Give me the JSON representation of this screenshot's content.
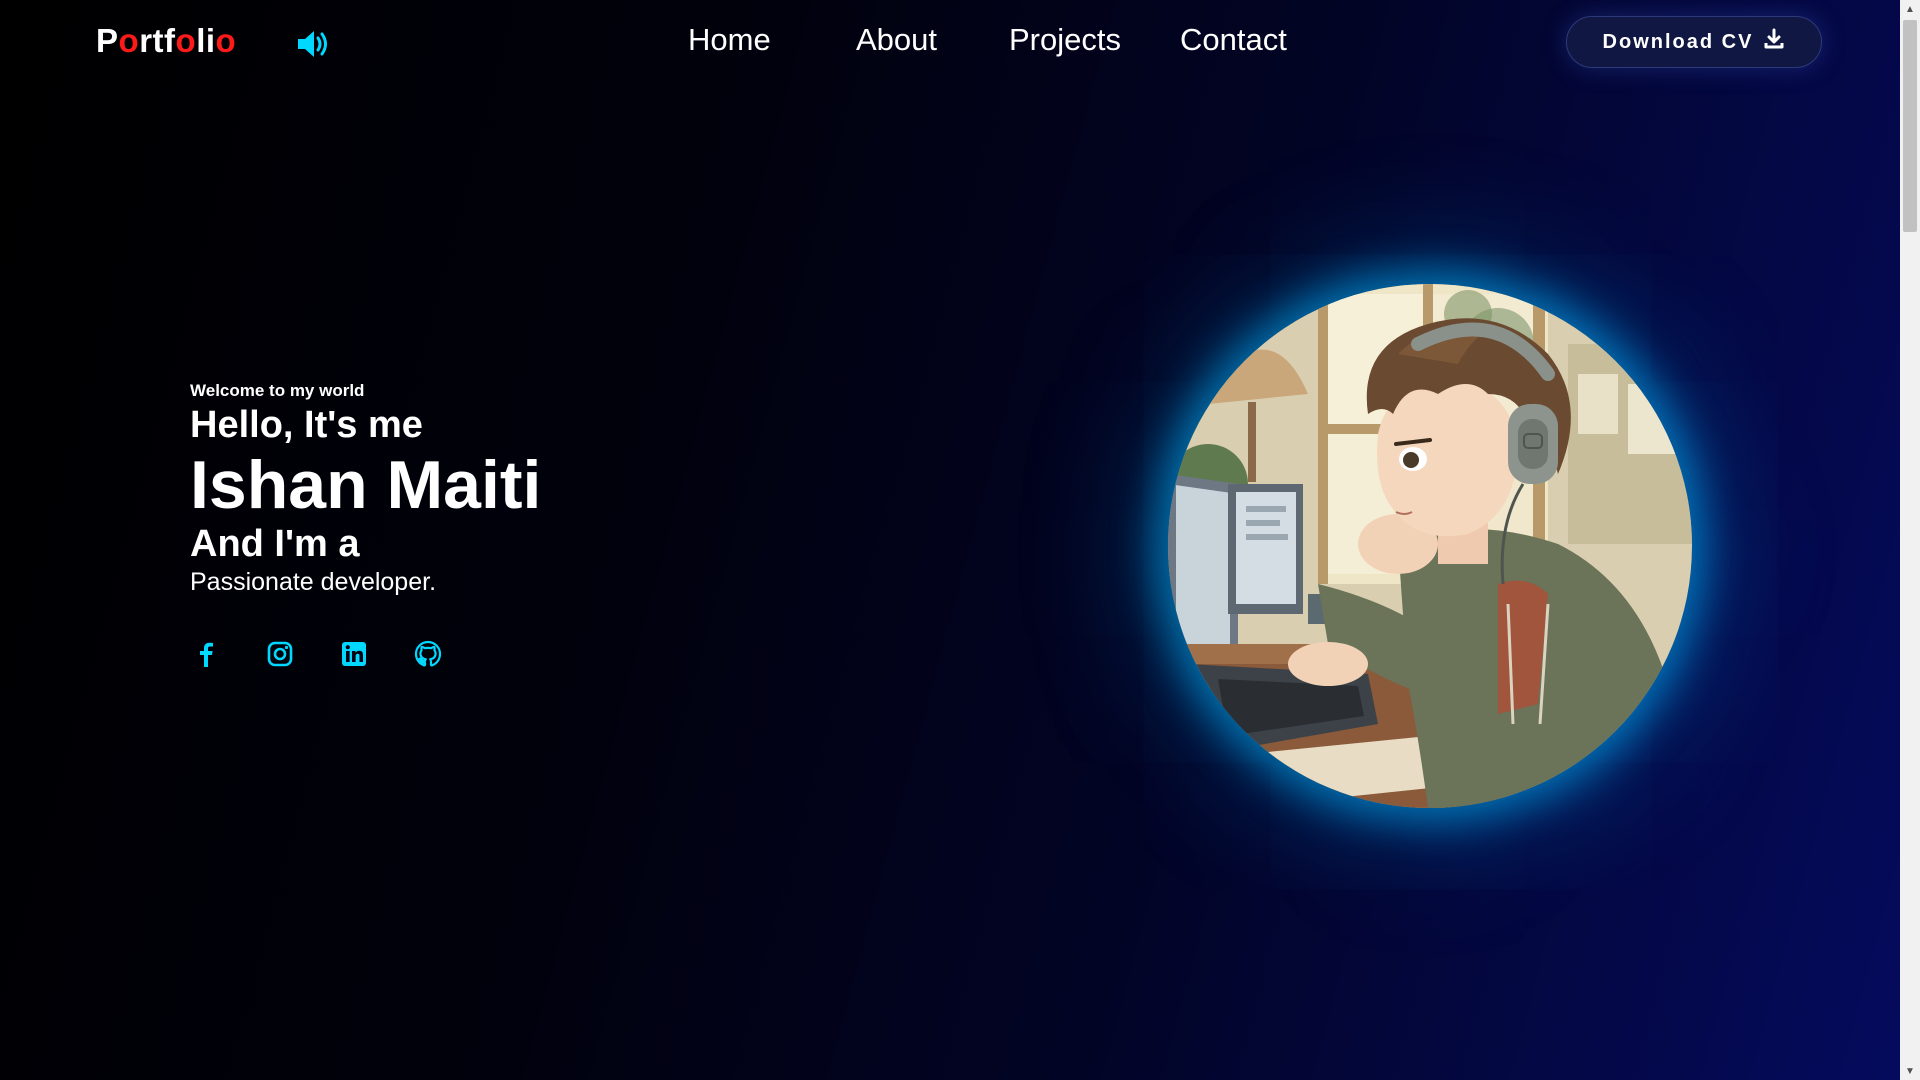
{
  "header": {
    "logo_letters": [
      {
        "char": "P",
        "color": "#ffffff"
      },
      {
        "char": "o",
        "color": "#ff1a1a"
      },
      {
        "char": "r",
        "color": "#ffffff"
      },
      {
        "char": "t",
        "color": "#ffffff"
      },
      {
        "char": "f",
        "color": "#ffffff"
      },
      {
        "char": "o",
        "color": "#ff1a1a"
      },
      {
        "char": "l",
        "color": "#ffffff"
      },
      {
        "char": "i",
        "color": "#ffffff"
      },
      {
        "char": "o",
        "color": "#ff1a1a"
      }
    ],
    "sound_icon": "volume-high-icon",
    "nav": [
      "Home",
      "About",
      "Projects",
      "Contact"
    ],
    "cv_button_label": "Download CV",
    "cv_button_icon": "download-icon"
  },
  "hero": {
    "welcome": "Welcome to my world",
    "greeting": "Hello, It's me",
    "name": "Ishan Maiti",
    "intro": "And I'm a",
    "role": "Passionate developer."
  },
  "socials": [
    {
      "icon": "facebook-icon"
    },
    {
      "icon": "instagram-icon"
    },
    {
      "icon": "linkedin-icon"
    },
    {
      "icon": "github-icon"
    }
  ],
  "avatar": {
    "icon": "profile-illustration"
  },
  "colors": {
    "accent": "#00d8ff",
    "logo_red": "#ff1a1a",
    "button_bg": "#0f1742"
  }
}
